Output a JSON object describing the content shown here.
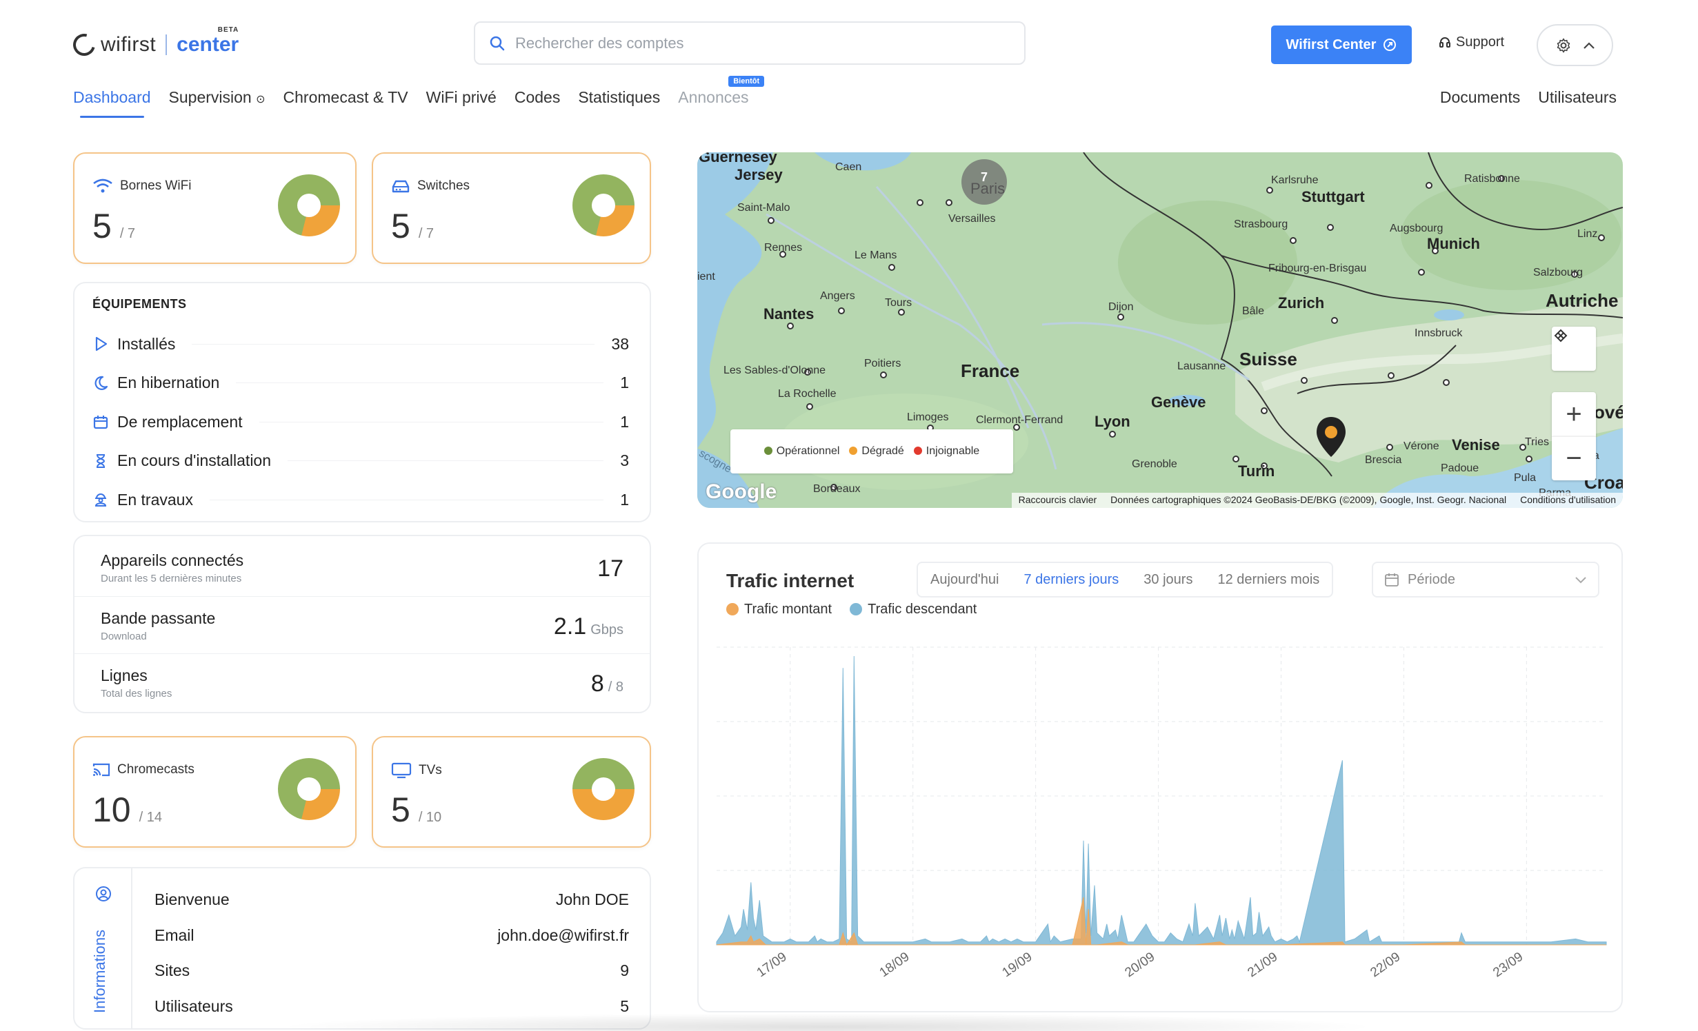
{
  "header": {
    "logo_text": "wifirst",
    "logo_badge": "BETA",
    "logo_product": "center",
    "search_placeholder": "Rechercher des comptes",
    "primary_button": "Wifirst Center",
    "support_label": "Support"
  },
  "nav": {
    "items": [
      {
        "label": "Dashboard",
        "active": true
      },
      {
        "label": "Supervision"
      },
      {
        "label": "Chromecast & TV"
      },
      {
        "label": "WiFi privé"
      },
      {
        "label": "Codes"
      },
      {
        "label": "Statistiques"
      },
      {
        "label": "Annonces",
        "disabled": true,
        "badge": "Bientôt"
      }
    ],
    "right_items": [
      "Documents",
      "Utilisateurs"
    ]
  },
  "kpis": {
    "bornes": {
      "label": "Bornes WiFi",
      "value": "5",
      "total": "/ 7",
      "ratio": 0.71
    },
    "switches": {
      "label": "Switches",
      "value": "5",
      "total": "/ 7",
      "ratio": 0.71
    },
    "chromecasts": {
      "label": "Chromecasts",
      "value": "10",
      "total": "/ 14",
      "ratio": 0.71
    },
    "tvs": {
      "label": "TVs",
      "value": "5",
      "total": "/ 10",
      "ratio": 0.5
    }
  },
  "equipements": {
    "title": "ÉQUIPEMENTS",
    "rows": [
      {
        "label": "Installés",
        "count": "38",
        "icon": "play-icon"
      },
      {
        "label": "En hibernation",
        "count": "1",
        "icon": "moon-icon"
      },
      {
        "label": "De remplacement",
        "count": "1",
        "icon": "box-icon"
      },
      {
        "label": "En cours d'installation",
        "count": "3",
        "icon": "hourglass-icon"
      },
      {
        "label": "En travaux",
        "count": "1",
        "icon": "worker-icon"
      }
    ]
  },
  "metrics": [
    {
      "label": "Appareils connectés",
      "sub": "Durant les 5 dernières minutes",
      "value": "17",
      "unit": ""
    },
    {
      "label": "Bande passante",
      "sub": "Download",
      "value": "2.1",
      "unit": "Gbps"
    },
    {
      "label": "Lignes",
      "sub": "Total des lignes",
      "value": "8",
      "unit": "/ 8"
    }
  ],
  "informations": {
    "title": "Informations",
    "rows": [
      {
        "label": "Bienvenue",
        "value": "John DOE"
      },
      {
        "label": "Email",
        "value": "john.doe@wifirst.fr"
      },
      {
        "label": "Sites",
        "value": "9"
      },
      {
        "label": "Utilisateurs",
        "value": "5"
      }
    ]
  },
  "map": {
    "cluster_count": "7",
    "legend": [
      {
        "label": "Opérationnel",
        "color": "#6b8f3a"
      },
      {
        "label": "Dégradé",
        "color": "#f0a030"
      },
      {
        "label": "Injoignable",
        "color": "#e23a2e"
      }
    ],
    "places": {
      "guernesey": "Guernesey",
      "jersey": "Jersey",
      "caen": "Caen",
      "paris": "Paris",
      "versailles": "Versailles",
      "saintmalo": "Saint-Malo",
      "rennes": "Rennes",
      "lemans": "Le Mans",
      "nantes": "Nantes",
      "angers": "Angers",
      "tours": "Tours",
      "ient": "ient",
      "sables": "Les Sables-d'Olonne",
      "poitiers": "Poitiers",
      "larochelle": "La Rochelle",
      "france": "France",
      "limoges": "Limoges",
      "clermont": "Clermont-Ferrand",
      "lyon": "Lyon",
      "dijon": "Dijon",
      "bordeaux": "Bordeaux",
      "karlsruhe": "Karlsruhe",
      "stuttgart": "Stuttgart",
      "strasbourg": "Strasbourg",
      "fribourg": "Fribourg-en-Brisgau",
      "bale": "Bâle",
      "zurich": "Zurich",
      "suisse": "Suisse",
      "lausanne": "Lausanne",
      "geneve": "Genève",
      "grenoble": "Grenoble",
      "turin": "Turin",
      "ratisbonne": "Ratisbonne",
      "augsbourg": "Augsbourg",
      "munich": "Munich",
      "linz": "Linz",
      "salzbourg": "Salzbourg",
      "autriche": "Autriche",
      "innsbruck": "Innsbruck",
      "slovenie": "ové",
      "verone": "Vérone",
      "venise": "Venise",
      "trieste": "Tries",
      "brescia": "Brescia",
      "padoue": "Padoue",
      "parme": "Parma",
      "pula": "Pula",
      "croatie": "Croa",
      "rijeka": "eka",
      "gascogne": "scogne"
    },
    "google": "Google",
    "attribution": [
      "Raccourcis clavier",
      "Données cartographiques ©2024 GeoBasis-DE/BKG (©2009), Google, Inst. Geogr. Nacional",
      "Conditions d'utilisation"
    ]
  },
  "traffic": {
    "title": "Trafic internet",
    "tabs": [
      "Aujourd'hui",
      "7 derniers jours",
      "30 jours",
      "12 derniers mois"
    ],
    "active_tab": 1,
    "period_placeholder": "Période",
    "legend": [
      {
        "label": "Trafic montant",
        "color": "#f0a85a"
      },
      {
        "label": "Trafic descendant",
        "color": "#7fb8d6"
      }
    ]
  },
  "chart_data": {
    "type": "area",
    "title": "Trafic internet",
    "x_ticks": [
      "17/09",
      "18/09",
      "19/09",
      "20/09",
      "21/09",
      "22/09",
      "23/09"
    ],
    "xlim": [
      16.4,
      23.65
    ],
    "ylim": [
      0,
      100
    ],
    "grid": true,
    "legend_position": "top-left",
    "series": [
      {
        "name": "Trafic descendant",
        "color": "#7fb8d6",
        "points": [
          [
            16.4,
            1
          ],
          [
            16.45,
            4
          ],
          [
            16.5,
            10
          ],
          [
            16.55,
            3
          ],
          [
            16.6,
            6
          ],
          [
            16.62,
            12
          ],
          [
            16.65,
            5
          ],
          [
            16.68,
            21
          ],
          [
            16.7,
            9
          ],
          [
            16.72,
            5
          ],
          [
            16.75,
            15
          ],
          [
            16.78,
            3
          ],
          [
            16.85,
            1
          ],
          [
            16.95,
            1
          ],
          [
            17.0,
            2
          ],
          [
            17.05,
            1
          ],
          [
            17.1,
            1
          ],
          [
            17.15,
            1
          ],
          [
            17.2,
            3
          ],
          [
            17.22,
            1
          ],
          [
            17.25,
            2
          ],
          [
            17.3,
            1
          ],
          [
            17.35,
            1
          ],
          [
            17.4,
            2
          ],
          [
            17.43,
            93
          ],
          [
            17.46,
            2
          ],
          [
            17.5,
            1
          ],
          [
            17.52,
            97
          ],
          [
            17.55,
            3
          ],
          [
            17.6,
            1
          ],
          [
            17.7,
            1
          ],
          [
            17.8,
            1
          ],
          [
            17.9,
            1
          ],
          [
            18.0,
            1
          ],
          [
            18.1,
            2
          ],
          [
            18.15,
            1
          ],
          [
            18.2,
            1
          ],
          [
            18.25,
            1
          ],
          [
            18.3,
            1
          ],
          [
            18.4,
            2
          ],
          [
            18.45,
            1
          ],
          [
            18.55,
            1
          ],
          [
            18.6,
            3
          ],
          [
            18.62,
            1
          ],
          [
            18.65,
            2
          ],
          [
            18.7,
            1
          ],
          [
            18.75,
            2
          ],
          [
            18.8,
            1
          ],
          [
            18.85,
            2
          ],
          [
            18.9,
            1
          ],
          [
            19.0,
            1
          ],
          [
            19.1,
            7
          ],
          [
            19.12,
            1
          ],
          [
            19.15,
            3
          ],
          [
            19.2,
            1
          ],
          [
            19.3,
            2
          ],
          [
            19.34,
            2
          ],
          [
            19.37,
            2
          ],
          [
            19.39,
            35
          ],
          [
            19.41,
            4
          ],
          [
            19.43,
            34
          ],
          [
            19.45,
            3
          ],
          [
            19.48,
            20
          ],
          [
            19.5,
            4
          ],
          [
            19.55,
            2
          ],
          [
            19.58,
            7
          ],
          [
            19.6,
            3
          ],
          [
            19.65,
            5
          ],
          [
            19.67,
            2
          ],
          [
            19.7,
            10
          ],
          [
            19.75,
            1
          ],
          [
            19.8,
            1
          ],
          [
            19.9,
            7
          ],
          [
            19.95,
            3
          ],
          [
            20.0,
            1
          ],
          [
            20.05,
            1
          ],
          [
            20.1,
            4
          ],
          [
            20.15,
            2
          ],
          [
            20.2,
            1
          ],
          [
            20.25,
            7
          ],
          [
            20.28,
            3
          ],
          [
            20.3,
            14
          ],
          [
            20.33,
            3
          ],
          [
            20.4,
            6
          ],
          [
            20.45,
            2
          ],
          [
            20.5,
            10
          ],
          [
            20.52,
            3
          ],
          [
            20.55,
            9
          ],
          [
            20.58,
            2
          ],
          [
            20.6,
            5
          ],
          [
            20.62,
            2
          ],
          [
            20.65,
            8
          ],
          [
            20.7,
            2
          ],
          [
            20.75,
            16
          ],
          [
            20.77,
            3
          ],
          [
            20.8,
            4
          ],
          [
            20.82,
            11
          ],
          [
            20.85,
            3
          ],
          [
            20.9,
            6
          ],
          [
            20.92,
            3
          ],
          [
            20.95,
            1
          ],
          [
            21.0,
            2
          ],
          [
            21.05,
            1
          ],
          [
            21.1,
            2
          ],
          [
            21.13,
            3
          ],
          [
            21.15,
            1
          ],
          [
            21.5,
            62
          ],
          [
            21.52,
            1
          ],
          [
            21.6,
            2
          ],
          [
            21.7,
            5
          ],
          [
            21.72,
            1
          ],
          [
            21.8,
            3
          ],
          [
            21.82,
            1
          ],
          [
            21.9,
            1
          ],
          [
            22.0,
            1
          ],
          [
            22.1,
            1
          ],
          [
            22.2,
            1
          ],
          [
            22.3,
            1
          ],
          [
            22.4,
            1
          ],
          [
            22.45,
            1
          ],
          [
            22.47,
            4
          ],
          [
            22.5,
            1
          ],
          [
            22.6,
            1
          ],
          [
            22.8,
            1
          ],
          [
            23.0,
            1
          ],
          [
            23.2,
            1
          ],
          [
            23.4,
            2
          ],
          [
            23.5,
            1
          ],
          [
            23.6,
            1
          ],
          [
            23.65,
            1
          ]
        ]
      },
      {
        "name": "Trafic montant",
        "color": "#f0a85a",
        "points": [
          [
            16.4,
            0
          ],
          [
            16.6,
            1
          ],
          [
            16.65,
            1
          ],
          [
            16.68,
            3
          ],
          [
            16.7,
            1
          ],
          [
            16.75,
            2
          ],
          [
            16.8,
            0
          ],
          [
            17.0,
            0
          ],
          [
            17.4,
            0
          ],
          [
            17.43,
            4
          ],
          [
            17.46,
            0
          ],
          [
            17.52,
            4
          ],
          [
            17.55,
            0
          ],
          [
            18.0,
            0
          ],
          [
            18.5,
            0
          ],
          [
            19.3,
            0
          ],
          [
            19.39,
            16
          ],
          [
            19.41,
            0
          ],
          [
            19.43,
            12
          ],
          [
            19.45,
            0
          ],
          [
            19.5,
            0
          ],
          [
            19.7,
            1
          ],
          [
            19.75,
            0
          ],
          [
            20.0,
            0
          ],
          [
            20.3,
            0
          ],
          [
            20.5,
            1
          ],
          [
            20.55,
            0
          ],
          [
            21.0,
            0
          ],
          [
            21.5,
            1
          ],
          [
            21.52,
            0
          ],
          [
            22.0,
            0
          ],
          [
            22.47,
            1
          ],
          [
            22.5,
            0
          ],
          [
            23.0,
            0
          ],
          [
            23.65,
            0
          ]
        ]
      }
    ]
  }
}
